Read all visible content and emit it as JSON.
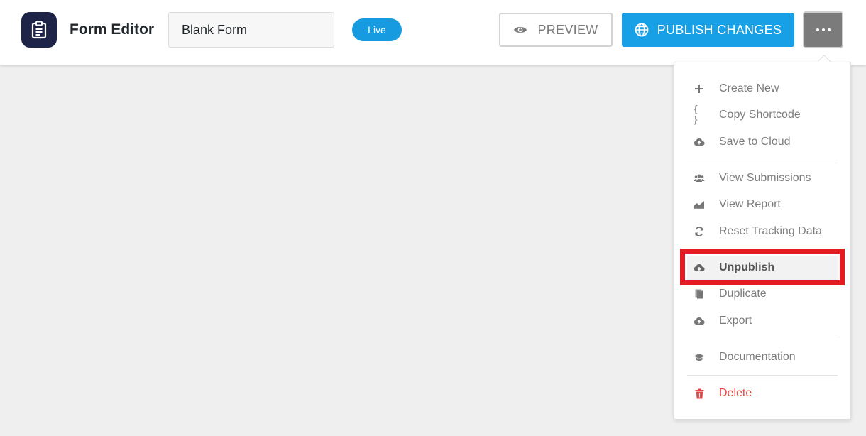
{
  "header": {
    "app_title": "Form Editor",
    "form_name": "Blank Form",
    "status": "Live",
    "preview_label": "PREVIEW",
    "publish_label": "PUBLISH CHANGES"
  },
  "menu": {
    "items": [
      {
        "label": "Create New",
        "icon": "plus-icon"
      },
      {
        "label": "Copy Shortcode",
        "icon": "braces-icon"
      },
      {
        "label": "Save to Cloud",
        "icon": "cloud-upload-icon"
      },
      {
        "label": "View Submissions",
        "icon": "users-icon"
      },
      {
        "label": "View Report",
        "icon": "chart-icon"
      },
      {
        "label": "Reset Tracking Data",
        "icon": "refresh-icon"
      },
      {
        "label": "Unpublish",
        "icon": "cloud-download-icon"
      },
      {
        "label": "Duplicate",
        "icon": "copy-icon"
      },
      {
        "label": "Export",
        "icon": "export-icon"
      },
      {
        "label": "Documentation",
        "icon": "graduation-cap-icon"
      },
      {
        "label": "Delete",
        "icon": "trash-icon"
      }
    ]
  },
  "colors": {
    "accent": "#17a0e5",
    "logo_bg": "#1d2447",
    "delete": "#e64545",
    "highlight": "#e41b23"
  }
}
